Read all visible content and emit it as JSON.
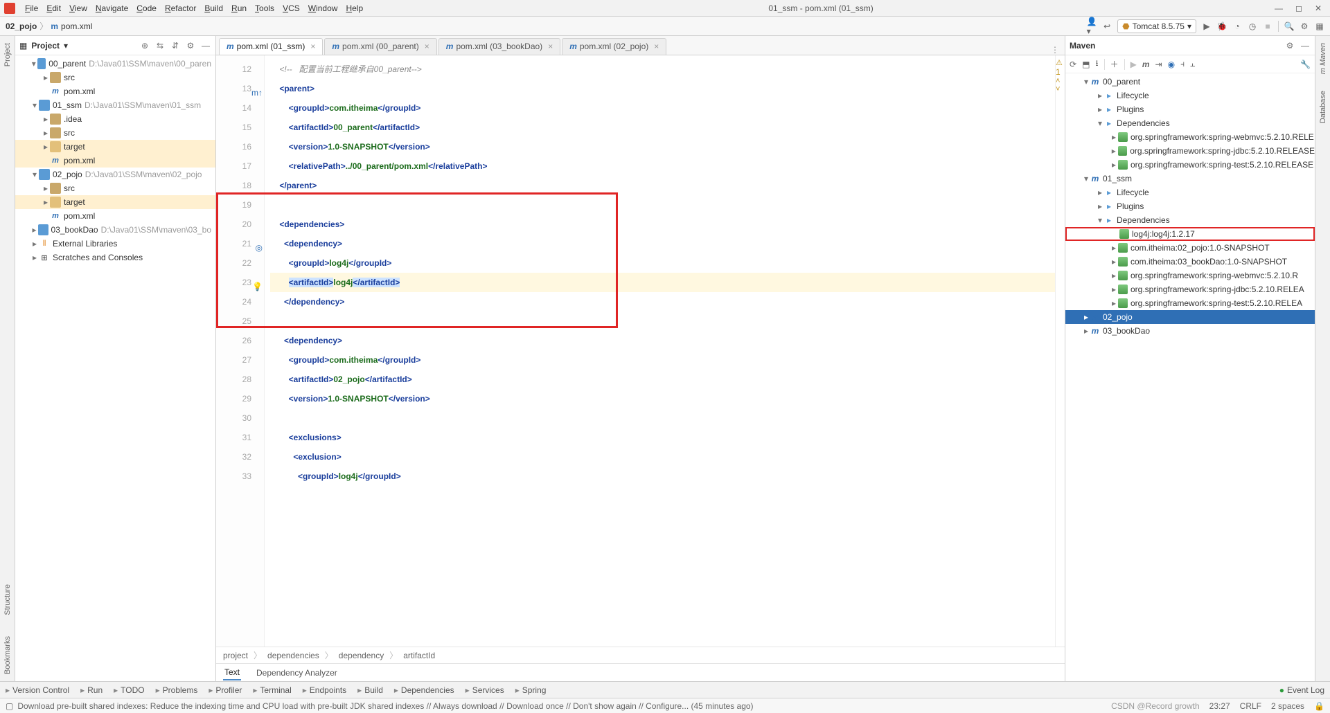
{
  "menu": {
    "items": [
      "File",
      "Edit",
      "View",
      "Navigate",
      "Code",
      "Refactor",
      "Build",
      "Run",
      "Tools",
      "VCS",
      "Window",
      "Help"
    ],
    "title": "01_ssm - pom.xml (01_ssm)"
  },
  "nav": {
    "crumb1": "02_pojo",
    "file": "pom.xml",
    "runcfg": "Tomcat 8.5.75"
  },
  "project": {
    "title": "Project",
    "nodes": [
      {
        "d": 1,
        "arr": "▾",
        "ico": "mod",
        "lbl": "00_parent",
        "path": "D:\\Java01\\SSM\\maven\\00_paren"
      },
      {
        "d": 2,
        "arr": "▸",
        "ico": "fold",
        "lbl": "src"
      },
      {
        "d": 2,
        "arr": "",
        "ico": "m",
        "lbl": "pom.xml"
      },
      {
        "d": 1,
        "arr": "▾",
        "ico": "mod",
        "lbl": "01_ssm",
        "path": "D:\\Java01\\SSM\\maven\\01_ssm"
      },
      {
        "d": 2,
        "arr": "▸",
        "ico": "fold",
        "lbl": ".idea"
      },
      {
        "d": 2,
        "arr": "▸",
        "ico": "fold",
        "lbl": "src"
      },
      {
        "d": 2,
        "arr": "▸",
        "ico": "fold2",
        "lbl": "target",
        "sel": true
      },
      {
        "d": 2,
        "arr": "",
        "ico": "m",
        "lbl": "pom.xml",
        "sel": true
      },
      {
        "d": 1,
        "arr": "▾",
        "ico": "mod",
        "lbl": "02_pojo",
        "path": "D:\\Java01\\SSM\\maven\\02_pojo"
      },
      {
        "d": 2,
        "arr": "▸",
        "ico": "fold",
        "lbl": "src"
      },
      {
        "d": 2,
        "arr": "▸",
        "ico": "fold2",
        "lbl": "target",
        "sel": true
      },
      {
        "d": 2,
        "arr": "",
        "ico": "m",
        "lbl": "pom.xml"
      },
      {
        "d": 1,
        "arr": "▸",
        "ico": "mod",
        "lbl": "03_bookDao",
        "path": "D:\\Java01\\SSM\\maven\\03_bo"
      },
      {
        "d": 1,
        "arr": "▸",
        "ico": "lib",
        "lbl": "External Libraries"
      },
      {
        "d": 1,
        "arr": "▸",
        "ico": "scr",
        "lbl": "Scratches and Consoles"
      }
    ]
  },
  "tabs": [
    {
      "lbl": "pom.xml (01_ssm)",
      "active": true
    },
    {
      "lbl": "pom.xml (00_parent)"
    },
    {
      "lbl": "pom.xml (03_bookDao)"
    },
    {
      "lbl": "pom.xml (02_pojo)"
    }
  ],
  "lines": {
    "start": 12,
    "end": 33
  },
  "code": {
    "l12": {
      "cm": "<!--   配置当前工程继承自00_parent-->"
    },
    "l13": {
      "open": "parent"
    },
    "l14": {
      "t": "groupId",
      "v": "com.itheima"
    },
    "l15": {
      "t": "artifactId",
      "v": "00_parent"
    },
    "l16": {
      "t": "version",
      "v": "1.0-SNAPSHOT"
    },
    "l17": {
      "t": "relativePath",
      "v": "../00_parent/pom.xml"
    },
    "l18": {
      "close": "parent"
    },
    "l20": {
      "open": "dependencies"
    },
    "l21": {
      "open": "dependency"
    },
    "l22": {
      "t": "groupId",
      "v": "log4j"
    },
    "l23": {
      "t": "artifactId",
      "v": "log4j"
    },
    "l24": {
      "close": "dependency"
    },
    "l26": {
      "open": "dependency"
    },
    "l27": {
      "t": "groupId",
      "v": "com.itheima"
    },
    "l28": {
      "t": "artifactId",
      "v": "02_pojo"
    },
    "l29": {
      "t": "version",
      "v": "1.0-SNAPSHOT"
    },
    "l31": {
      "open": "exclusions"
    },
    "l32": {
      "open": "exclusion"
    },
    "l33": {
      "t": "groupId",
      "v": "log4j"
    }
  },
  "crumbs2": [
    "project",
    "dependencies",
    "dependency",
    "artifactId"
  ],
  "edTabs2": [
    "Text",
    "Dependency Analyzer"
  ],
  "warn": "1",
  "maven": {
    "title": "Maven",
    "nodes": [
      {
        "d": 0,
        "arr": "▾",
        "ico": "mgrp",
        "lbl": "00_parent"
      },
      {
        "d": 1,
        "arr": "▸",
        "ico": "fold",
        "lbl": "Lifecycle"
      },
      {
        "d": 1,
        "arr": "▸",
        "ico": "fold",
        "lbl": "Plugins"
      },
      {
        "d": 1,
        "arr": "▾",
        "ico": "fold",
        "lbl": "Dependencies"
      },
      {
        "d": 2,
        "arr": "▸",
        "ico": "jar",
        "lbl": "org.springframework:spring-webmvc:5.2.10.RELE"
      },
      {
        "d": 2,
        "arr": "▸",
        "ico": "jar",
        "lbl": "org.springframework:spring-jdbc:5.2.10.RELEASE"
      },
      {
        "d": 2,
        "arr": "▸",
        "ico": "jar",
        "lbl": "org.springframework:spring-test:5.2.10.RELEASE"
      },
      {
        "d": 0,
        "arr": "▾",
        "ico": "mgrp",
        "lbl": "01_ssm"
      },
      {
        "d": 1,
        "arr": "▸",
        "ico": "fold",
        "lbl": "Lifecycle"
      },
      {
        "d": 1,
        "arr": "▸",
        "ico": "fold",
        "lbl": "Plugins"
      },
      {
        "d": 1,
        "arr": "▾",
        "ico": "fold",
        "lbl": "Dependencies"
      },
      {
        "d": 2,
        "arr": "",
        "ico": "jar",
        "lbl": "log4j:log4j:1.2.17",
        "boxed": true
      },
      {
        "d": 2,
        "arr": "▸",
        "ico": "jar",
        "lbl": "com.itheima:02_pojo:1.0-SNAPSHOT"
      },
      {
        "d": 2,
        "arr": "▸",
        "ico": "jar",
        "lbl": "com.itheima:03_bookDao:1.0-SNAPSHOT"
      },
      {
        "d": 2,
        "arr": "▸",
        "ico": "jar",
        "lbl": "org.springframework:spring-webmvc:5.2.10.R"
      },
      {
        "d": 2,
        "arr": "▸",
        "ico": "jar",
        "lbl": "org.springframework:spring-jdbc:5.2.10.RELEA"
      },
      {
        "d": 2,
        "arr": "▸",
        "ico": "jar",
        "lbl": "org.springframework:spring-test:5.2.10.RELEA"
      },
      {
        "d": 0,
        "arr": "▸",
        "ico": "mgrp",
        "lbl": "02_pojo",
        "sel": true
      },
      {
        "d": 0,
        "arr": "▸",
        "ico": "mgrp",
        "lbl": "03_bookDao"
      }
    ]
  },
  "bottombar": [
    "Version Control",
    "Run",
    "TODO",
    "Problems",
    "Profiler",
    "Terminal",
    "Endpoints",
    "Build",
    "Dependencies",
    "Services",
    "Spring"
  ],
  "eventlog": "Event Log",
  "status": {
    "msg": "Download pre-built shared indexes: Reduce the indexing time and CPU load with pre-built JDK shared indexes // Always download // Download once // Don't show again // Configure... (45 minutes ago)",
    "time": "23:27",
    "enc": "CRLF",
    "sp": "2 spaces"
  },
  "watermark": "CSDN @Record growth"
}
